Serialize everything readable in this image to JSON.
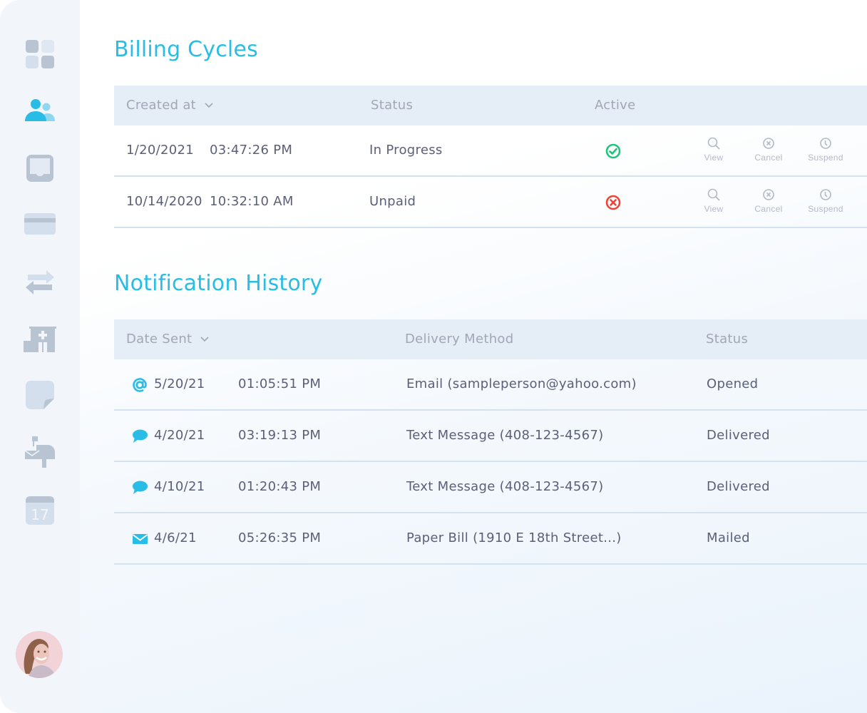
{
  "colors": {
    "accent": "#29bde6",
    "active_ok": "#1fc47a",
    "active_bad": "#ef4238",
    "header_bg": "#e5edf6",
    "muted_icon": "#b4b9c8"
  },
  "sidebar": {
    "items": [
      {
        "name": "dashboard",
        "icon": "grid-icon",
        "active": false
      },
      {
        "name": "users",
        "icon": "users-icon",
        "active": true
      },
      {
        "name": "inbox",
        "icon": "inbox-tray-icon",
        "active": false
      },
      {
        "name": "billing",
        "icon": "credit-card-icon",
        "active": false
      },
      {
        "name": "transfers",
        "icon": "transfer-arrows-icon",
        "active": false
      },
      {
        "name": "hospital",
        "icon": "hospital-icon",
        "active": false
      },
      {
        "name": "notes",
        "icon": "sticky-note-icon",
        "active": false
      },
      {
        "name": "mailbox",
        "icon": "mailbox-icon",
        "active": false
      },
      {
        "name": "calendar",
        "icon": "calendar-icon",
        "active": false,
        "label": "17"
      }
    ],
    "avatar": {
      "icon": "user-avatar"
    }
  },
  "billing": {
    "title": "Billing Cycles",
    "columns": {
      "created_at": "Created at",
      "status": "Status",
      "active": "Active"
    },
    "rows": [
      {
        "date": "1/20/2021",
        "time": "03:47:26 PM",
        "status": "In Progress",
        "active": true
      },
      {
        "date": "10/14/2020",
        "time": "10:32:10 AM",
        "status": "Unpaid",
        "active": false
      }
    ],
    "actions": {
      "view": "View",
      "cancel": "Cancel",
      "suspend": "Suspend"
    }
  },
  "notifications": {
    "title": "Notification History",
    "columns": {
      "date_sent": "Date Sent",
      "delivery_method": "Delivery Method",
      "status": "Status"
    },
    "rows": [
      {
        "icon": "at-sign-icon",
        "date": "5/20/21",
        "time": "01:05:51 PM",
        "method": "Email (sampleperson@yahoo.com)",
        "status": "Opened"
      },
      {
        "icon": "chat-bubble-icon",
        "date": "4/20/21",
        "time": "03:19:13 PM",
        "method": "Text Message (408-123-4567)",
        "status": "Delivered"
      },
      {
        "icon": "chat-bubble-icon",
        "date": "4/10/21",
        "time": "01:20:43 PM",
        "method": "Text Message (408-123-4567)",
        "status": "Delivered"
      },
      {
        "icon": "envelope-icon",
        "date": "4/6/21",
        "time": "05:26:35 PM",
        "method": "Paper Bill (1910 E 18th Street...)",
        "status": "Mailed"
      }
    ]
  }
}
